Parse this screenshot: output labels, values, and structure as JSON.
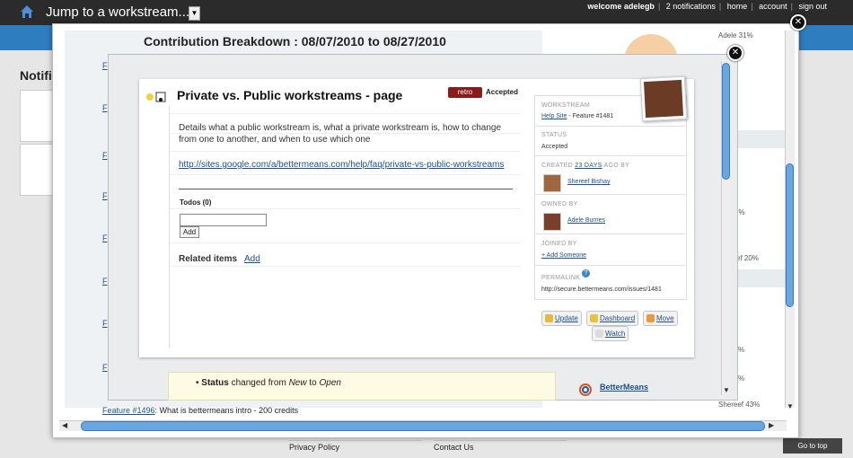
{
  "topbar": {
    "jump_label": "Jump to a workstream...",
    "links": [
      "welcome adelegb",
      "2 notifications",
      "home",
      "account",
      "sign out"
    ]
  },
  "background": {
    "notifications_heading": "Notifi",
    "footer_links": [
      "Privacy Policy",
      "Contact Us"
    ],
    "go_to_top": "Go to top"
  },
  "contribution": {
    "title": "Contribution Breakdown : 08/07/2010 to 08/27/2010",
    "feature_link": "Feature #1496",
    "feature_text": ": What is bettermeans intro - 200 credits",
    "pie_labels": [
      "Adele 31%",
      "3%",
      "ef 20%",
      "%",
      "%",
      "Shereef 43%"
    ]
  },
  "issue": {
    "title": "Private vs. Public workstreams - page",
    "tag": "retro",
    "state": "Accepted",
    "description": "Details what a public workstream is, what a private workstream is, how to change from one to another, and when to use which one",
    "url": "http://sites.google.com/a/bettermeans.com/help/faq/private-vs-public-workstreams",
    "todos_label": "Todos (0)",
    "add_button": "Add",
    "related_label": "Related items",
    "related_add": "Add",
    "status_change": {
      "prefix": "Status",
      "mid": " changed from ",
      "from": "New",
      "to_word": " to ",
      "to": "Open"
    },
    "activity_user": "BetterMeans"
  },
  "sidebar": {
    "workstream_label": "WORKSTREAM",
    "workstream_link": "Help Site",
    "workstream_feature": " - Feature #1481",
    "status_label": "STATUS",
    "status_value": "Accepted",
    "created_prefix": "CREATED ",
    "created_days": "23 DAYS",
    "created_suffix": " AGO BY",
    "creator": "Shereef Bishay",
    "owned_label": "OWNED BY",
    "owner": "Adele Burnes",
    "joined_label": "JOINED BY",
    "add_someone": "+ Add Someone",
    "permalink_label": "PERMALINK",
    "permalink_value": "http://secure.bettermeans.com/issues/1481"
  },
  "actions": [
    "Update",
    "Dashboard",
    "Move",
    "Watch"
  ],
  "colors": {
    "topbar": "#2b2b2b",
    "accent_blue": "#2e7dbf",
    "retro_tag": "#8b1a1a",
    "link": "#1d4f8a"
  }
}
